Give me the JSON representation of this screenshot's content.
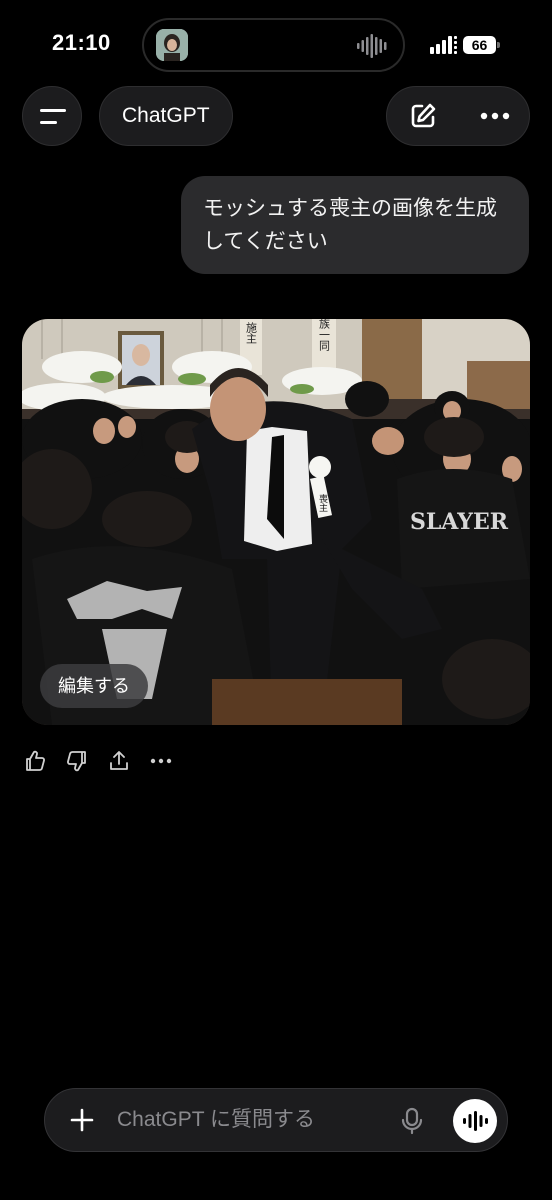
{
  "status_bar": {
    "time": "21:10",
    "battery": "66",
    "icons": [
      "island-avatar",
      "audio-wave-icon",
      "signal-icon",
      "battery-icon"
    ]
  },
  "header": {
    "title": "ChatGPT",
    "icons": [
      "menu-icon",
      "new-chat-icon",
      "more-icon"
    ]
  },
  "conversation": {
    "user_message": "モッシュする喪主の画像を生成してください",
    "image": {
      "edit_label": "編集する",
      "scene_text": {
        "banner_left": "施主",
        "banner_right": "家族一同",
        "rosette": "喪主",
        "shirt": "SLAYER"
      }
    },
    "feedback_icons": [
      "thumbs-up-icon",
      "thumbs-down-icon",
      "share-icon",
      "more-icon"
    ]
  },
  "composer": {
    "placeholder": "ChatGPT に質問する",
    "icons": [
      "plus-icon",
      "mic-icon",
      "voice-mode-icon"
    ]
  }
}
